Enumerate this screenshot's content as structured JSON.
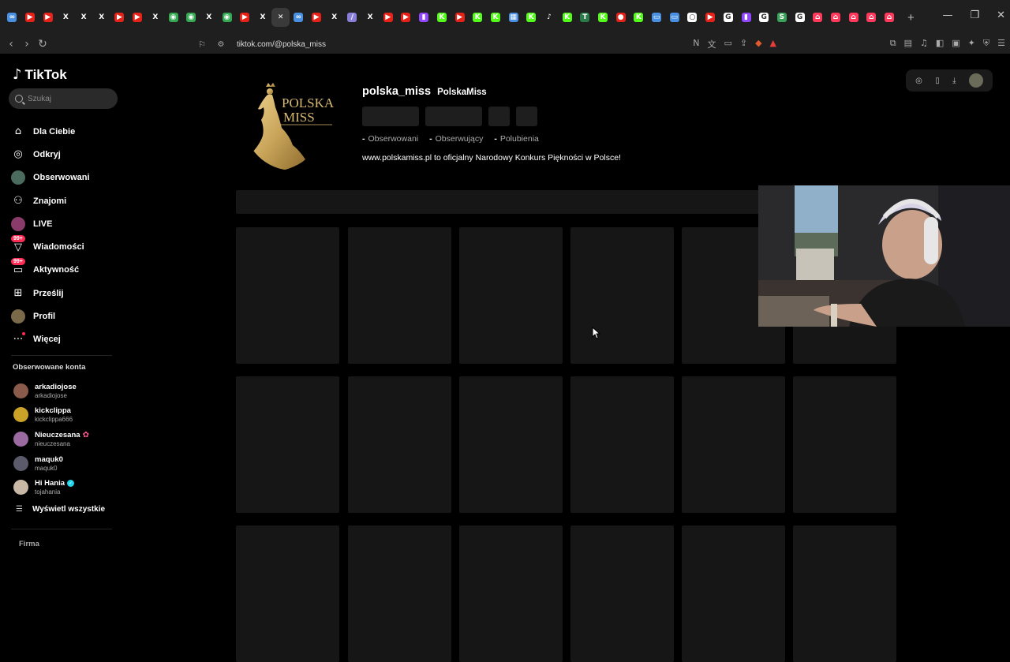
{
  "browser": {
    "tabs": [
      {
        "icon": "chatgpt-icon",
        "color": "#4a90e2",
        "glyph": "∞"
      },
      {
        "icon": "youtube-icon",
        "color": "#e62117",
        "glyph": "▶"
      },
      {
        "icon": "youtube-icon",
        "color": "#e62117",
        "glyph": "▶"
      },
      {
        "icon": "x-icon",
        "color": "#1f1f1f",
        "glyph": "X"
      },
      {
        "icon": "x-icon",
        "color": "#1f1f1f",
        "glyph": "X"
      },
      {
        "icon": "x-icon",
        "color": "#1f1f1f",
        "glyph": "X"
      },
      {
        "icon": "youtube-icon",
        "color": "#e62117",
        "glyph": "▶"
      },
      {
        "icon": "youtube-icon",
        "color": "#e62117",
        "glyph": "▶"
      },
      {
        "icon": "x-icon",
        "color": "#1f1f1f",
        "glyph": "X"
      },
      {
        "icon": "maps-icon",
        "color": "#34a853",
        "glyph": "◉"
      },
      {
        "icon": "maps-icon",
        "color": "#34a853",
        "glyph": "◉"
      },
      {
        "icon": "x-icon",
        "color": "#1f1f1f",
        "glyph": "X"
      },
      {
        "icon": "maps-icon",
        "color": "#34a853",
        "glyph": "◉"
      },
      {
        "icon": "youtube-icon",
        "color": "#e62117",
        "glyph": "▶"
      },
      {
        "icon": "x-icon",
        "color": "#1f1f1f",
        "glyph": "X"
      },
      {
        "icon": "tiktok-icon",
        "color": "#3a3a3a",
        "glyph": "✕",
        "active": true
      },
      {
        "icon": "chatgpt-icon",
        "color": "#4a90e2",
        "glyph": "∞"
      },
      {
        "icon": "youtube-icon",
        "color": "#e62117",
        "glyph": "▶"
      },
      {
        "icon": "x-icon",
        "color": "#1f1f1f",
        "glyph": "X"
      },
      {
        "icon": "feather-icon",
        "color": "#8a7fd8",
        "glyph": "∕"
      },
      {
        "icon": "x-icon",
        "color": "#1f1f1f",
        "glyph": "X"
      },
      {
        "icon": "youtube-icon",
        "color": "#e62117",
        "glyph": "▶"
      },
      {
        "icon": "youtube-icon",
        "color": "#e62117",
        "glyph": "▶"
      },
      {
        "icon": "twitch-icon",
        "color": "#9146ff",
        "glyph": "▮"
      },
      {
        "icon": "kick-icon",
        "color": "#53fc18",
        "glyph": "K"
      },
      {
        "icon": "youtube-icon",
        "color": "#e62117",
        "glyph": "▶"
      },
      {
        "icon": "kick-icon",
        "color": "#53fc18",
        "glyph": "K"
      },
      {
        "icon": "kick-icon",
        "color": "#53fc18",
        "glyph": "K"
      },
      {
        "icon": "chart-icon",
        "color": "#4a90e2",
        "glyph": "▦"
      },
      {
        "icon": "kick-icon",
        "color": "#53fc18",
        "glyph": "K"
      },
      {
        "icon": "tiktok-icon",
        "color": "#1f1f1f",
        "glyph": "♪"
      },
      {
        "icon": "kick-icon",
        "color": "#53fc18",
        "glyph": "K"
      },
      {
        "icon": "tt-icon",
        "color": "#2a7a4a",
        "glyph": "T"
      },
      {
        "icon": "kick-icon",
        "color": "#53fc18",
        "glyph": "K"
      },
      {
        "icon": "record-icon",
        "color": "#e62117",
        "glyph": "●"
      },
      {
        "icon": "kick-icon",
        "color": "#53fc18",
        "glyph": "K"
      },
      {
        "icon": "box-icon",
        "color": "#4a90e2",
        "glyph": "▭"
      },
      {
        "icon": "box-icon",
        "color": "#4a90e2",
        "glyph": "▭"
      },
      {
        "icon": "circle-icon",
        "color": "#ffffff",
        "glyph": "○"
      },
      {
        "icon": "youtube-icon",
        "color": "#e62117",
        "glyph": "▶"
      },
      {
        "icon": "google-icon",
        "color": "#ffffff",
        "glyph": "G"
      },
      {
        "icon": "twitch-icon",
        "color": "#9146ff",
        "glyph": "▮"
      },
      {
        "icon": "google-icon",
        "color": "#ffffff",
        "glyph": "G"
      },
      {
        "icon": "s-icon",
        "color": "#3aa35a",
        "glyph": "S"
      },
      {
        "icon": "google-icon",
        "color": "#ffffff",
        "glyph": "G"
      },
      {
        "icon": "airbnb-icon",
        "color": "#ff385c",
        "glyph": "⌂"
      },
      {
        "icon": "airbnb-icon",
        "color": "#ff385c",
        "glyph": "⌂"
      },
      {
        "icon": "airbnb-icon",
        "color": "#ff385c",
        "glyph": "⌂"
      },
      {
        "icon": "airbnb-icon",
        "color": "#ff385c",
        "glyph": "⌂"
      },
      {
        "icon": "airbnb-icon",
        "color": "#ff385c",
        "glyph": "⌂"
      }
    ],
    "url": "tiktok.com/@polska_miss"
  },
  "sidebar": {
    "brand": "TikTok",
    "search_placeholder": "Szukaj",
    "items": [
      {
        "label": "Dla Ciebie",
        "icon": "home-icon"
      },
      {
        "label": "Odkryj",
        "icon": "compass-icon"
      },
      {
        "label": "Obserwowani",
        "icon": "following-avatar-icon"
      },
      {
        "label": "Znajomi",
        "icon": "friends-icon"
      },
      {
        "label": "LIVE",
        "icon": "live-icon"
      },
      {
        "label": "Wiadomości",
        "icon": "messages-icon",
        "badge": "99+"
      },
      {
        "label": "Aktywność",
        "icon": "activity-icon",
        "badge": "99+"
      },
      {
        "label": "Prześlij",
        "icon": "upload-icon"
      },
      {
        "label": "Profil",
        "icon": "profile-avatar-icon"
      },
      {
        "label": "Więcej",
        "icon": "more-icon"
      }
    ],
    "followed_title": "Obserwowane konta",
    "followed": [
      {
        "name": "arkadiojose",
        "handle": "arkadiojose",
        "color": "#8a5a4a"
      },
      {
        "name": "kickclippa",
        "handle": "kickclippa666",
        "color": "#c9a227"
      },
      {
        "name": "Nieuczesana",
        "handle": "nieuczesana",
        "color": "#9a6aa0",
        "flower": true
      },
      {
        "name": "maquk0",
        "handle": "maquk0",
        "color": "#5a5a6a"
      },
      {
        "name": "Hi Hania",
        "handle": "tojahania",
        "color": "#c9b8a6",
        "verified": true
      }
    ],
    "show_all": "Wyświetl wszystkie",
    "footer": "Firma"
  },
  "profile": {
    "username": "polska_miss",
    "nickname": "PolskaMiss",
    "logo_text_1": "POLSKA",
    "logo_text_2": "MISS",
    "stats": [
      {
        "value": "-",
        "label": "Obserwowani"
      },
      {
        "value": "-",
        "label": "Obserwujący"
      },
      {
        "value": "-",
        "label": "Polubienia"
      }
    ],
    "bio": "www.polskamiss.pl to oficjalny Narodowy Konkurs Piękności w Polsce!"
  },
  "colors": {
    "accent": "#fe2c55",
    "background": "#000000",
    "skeleton": "#161616",
    "gold": "#c9a55a"
  }
}
